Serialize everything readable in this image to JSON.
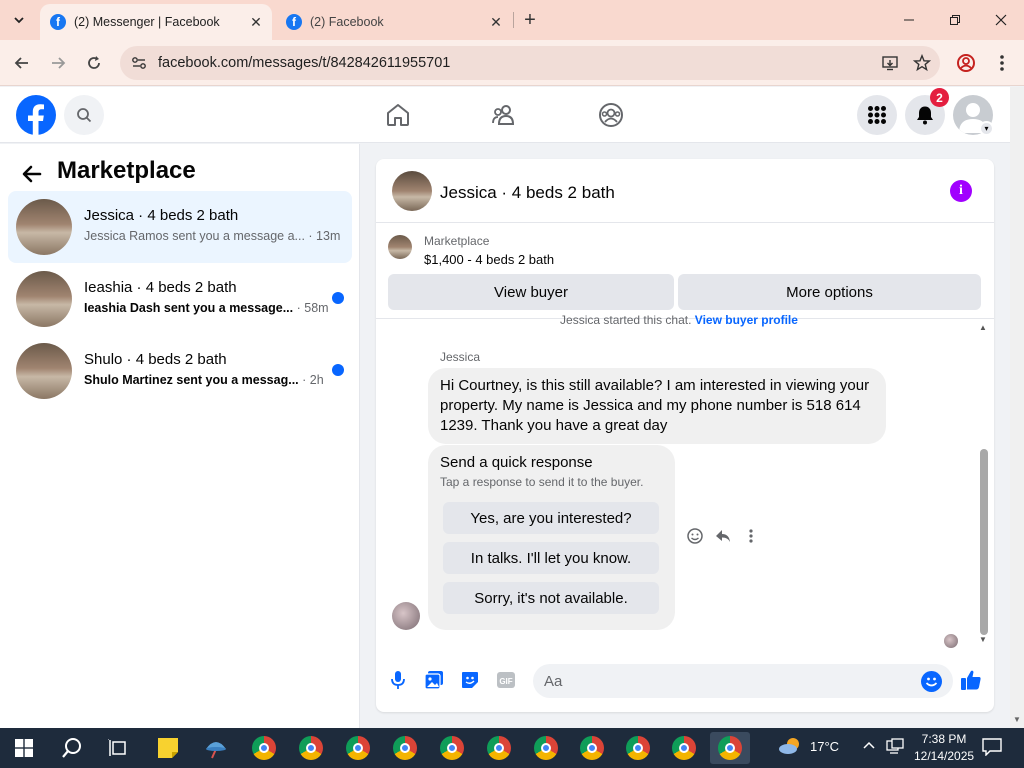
{
  "browser": {
    "tabs": [
      {
        "title": "(2) Messenger | Facebook",
        "active": true
      },
      {
        "title": "(2) Facebook",
        "active": false
      }
    ],
    "url": "facebook.com/messages/t/842842611955701"
  },
  "fb_header": {
    "notification_count": "2"
  },
  "left_panel": {
    "title": "Marketplace",
    "conversations": [
      {
        "name": "Jessica · 4 beds 2 bath",
        "preview": "Jessica Ramos sent you a message a...",
        "time": "· 13m",
        "unread": false,
        "selected": true
      },
      {
        "name": "Ieashia · 4 beds 2 bath",
        "preview": "Ieashia Dash sent you a message...",
        "time": "· 58m",
        "unread": true,
        "selected": false
      },
      {
        "name": "Shulo · 4 beds 2 bath",
        "preview": "Shulo Martinez sent you a messag...",
        "time": "· 2h",
        "unread": true,
        "selected": false
      }
    ]
  },
  "chat": {
    "title": "Jessica · 4 beds 2 bath",
    "marketplace_label": "Marketplace",
    "listing": "$1,400 - 4 beds 2 bath",
    "view_buyer_label": "View buyer",
    "more_options_label": "More options",
    "started_text": "Jessica started this chat.",
    "view_profile_link": "View buyer profile",
    "sender_name": "Jessica",
    "message": "Hi Courtney, is this still available? I am interested in viewing your property. My name is Jessica and my phone number is 518 614 1239. Thank you have a great day",
    "quick_response": {
      "title": "Send a quick response",
      "subtitle": "Tap a response to send it to the buyer.",
      "options": [
        "Yes, are you interested?",
        "In talks. I'll let you know.",
        "Sorry, it's not available."
      ]
    },
    "composer_placeholder": "Aa"
  },
  "taskbar": {
    "temperature": "17°C",
    "time": "7:38 PM",
    "date": "12/14/2025"
  },
  "colors": {
    "facebook_blue": "#0866ff",
    "badge_red": "#e41e3f",
    "info_purple": "#a100ff"
  }
}
